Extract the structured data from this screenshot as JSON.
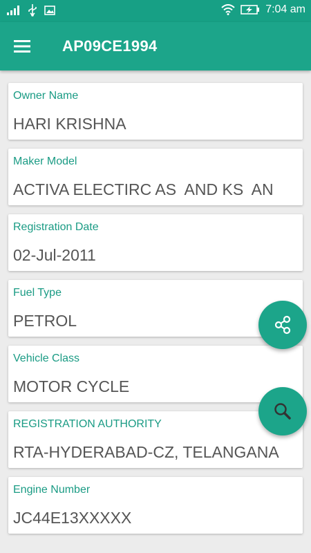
{
  "status_bar": {
    "time": "7:04 am",
    "icons": [
      "signal-icon",
      "usb-icon",
      "image-icon",
      "wifi-icon",
      "battery-charging-icon"
    ]
  },
  "toolbar": {
    "menu_icon": "hamburger-menu-icon",
    "title": "AP09CE1994"
  },
  "fields": [
    {
      "label": "Owner Name",
      "value": "HARI KRISHNA"
    },
    {
      "label": "Maker Model",
      "value": "ACTIVA ELECTIRC AS  AND KS  AN"
    },
    {
      "label": "Registration Date",
      "value": "02-Jul-2011"
    },
    {
      "label": "Fuel Type",
      "value": "PETROL"
    },
    {
      "label": "Vehicle Class",
      "value": "MOTOR CYCLE"
    },
    {
      "label": "REGISTRATION AUTHORITY",
      "value": "RTA-HYDERABAD-CZ, TELANGANA"
    },
    {
      "label": "Engine Number",
      "value": "JC44E13XXXXX"
    }
  ],
  "fabs": {
    "share_icon": "share-icon",
    "search_icon": "search-icon"
  },
  "colors": {
    "primary": "#1ca58a",
    "status_bar": "#17a085",
    "label": "#1a9b84",
    "value": "#555555",
    "background": "#ececec"
  }
}
